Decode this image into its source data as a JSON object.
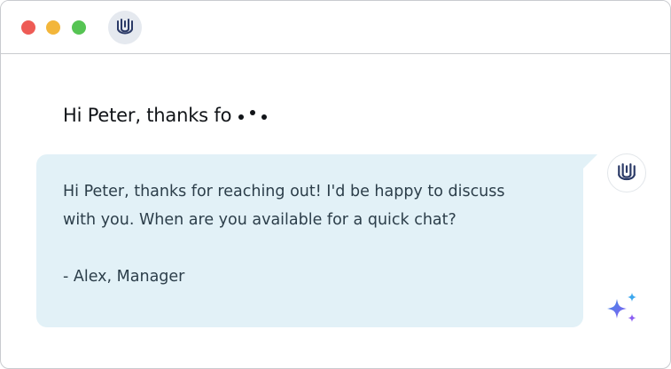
{
  "window": {
    "controls": [
      "close",
      "minimize",
      "maximize"
    ],
    "brand_icon": "zendesk-style-logo-icon"
  },
  "composer": {
    "draft_text": "Hi Peter, thanks fo",
    "typing_indicator": "typing-dots"
  },
  "reply": {
    "line_1": "Hi Peter, thanks for reaching out! I'd be happy to discuss",
    "line_2": "with you. When are you available for a quick chat?",
    "signature": "- Alex, Manager"
  },
  "assistant": {
    "avatar_icon": "brand-logo-icon",
    "ai_icon": "sparkle-icon"
  },
  "colors": {
    "bubble_bg": "#e2f1f7",
    "close": "#ee5b55",
    "minimize": "#f3b63a",
    "maximize": "#56c453",
    "logo": "#2b3a67",
    "sparkle_blue": "#3d8de6",
    "sparkle_purple": "#8a5cf2"
  }
}
